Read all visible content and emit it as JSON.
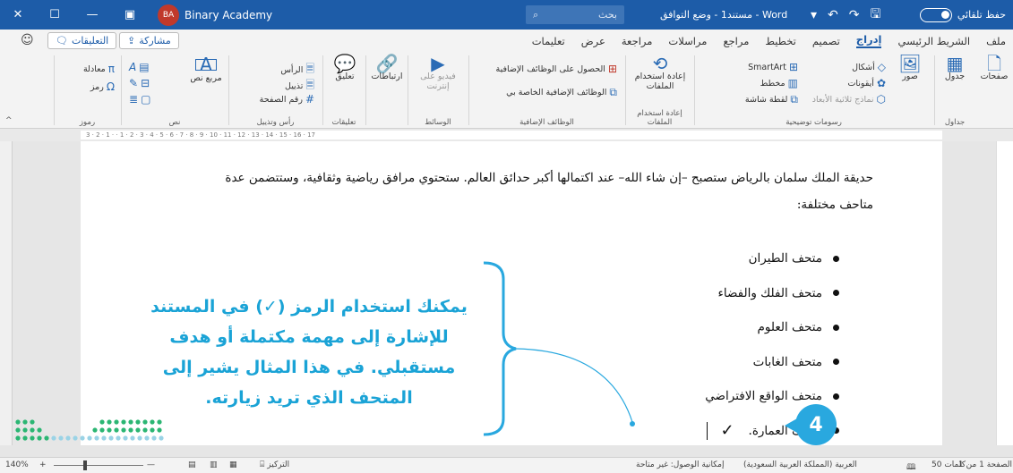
{
  "titlebar": {
    "account_initials": "BA",
    "account_name": "Binary Academy",
    "search_placeholder": "بحث",
    "doc_title": "مستند1 - وضع التوافق - Word",
    "autosave_label": "حفظ تلقائي"
  },
  "tabs": [
    "ملف",
    "الشريط الرئيسي",
    "إدراج",
    "تصميم",
    "تخطيط",
    "مراجع",
    "مراسلات",
    "مراجعة",
    "عرض",
    "تعليمات"
  ],
  "active_tab": "إدراج",
  "share_label": "مشاركة",
  "comments_label": "التعليقات",
  "ribbon": {
    "pages": "صفحات",
    "table": "جدول",
    "tables_group": "جداول",
    "pictures": "صور",
    "shapes": "أشكال",
    "icons": "أيقونات",
    "models_3d": "نماذج ثلاثية الأبعاد",
    "smartart": "SmartArt",
    "chart": "مخطط",
    "screenshot": "لقطة شاشة",
    "illustrations_group": "رسومات توضيحية",
    "reuse_files": "إعادة استخدام الملفات",
    "reuse_group": "إعادة استخدام الملفات",
    "get_addins": "الحصول على الوظائف الإضافية",
    "my_addins": "الوظائف الإضافية الخاصة بي",
    "addins_group": "الوظائف الإضافية",
    "online_video": "فيديو على إنترنت",
    "media_group": "الوسائط",
    "links": "ارتباطات",
    "comment": "تعليق",
    "comments_group": "تعليقات",
    "header": "الرأس",
    "footer": "تذييل",
    "page_number": "رقم الصفحة",
    "header_footer_group": "رأس وتذييل",
    "text_box": "مربع نص",
    "text_group": "نص",
    "equation": "معادلة",
    "symbol": "رمز",
    "symbols_group": "رموز"
  },
  "ruler_ticks": "3 · 2 · 1 · · 1 · 2 · 3 · 4 · 5 · 6 · 7 · 8 · 9 · 10 · 11 · 12 · 13 · 14 · 15 · 16 · 17",
  "document": {
    "paragraph": "حديقة الملك سلمان بالرياض ستصبح –إن شاء الله– عند اكتمالها أكبر حدائق العالم. ستحتوي مرافق رياضية وثقافية، وستتضمن عدة متاحف مختلفة:",
    "bullets": [
      "متحف الطيران",
      "متحف الفلك والفضاء",
      "متحف العلوم",
      "متحف الغابات",
      "متحف الواقع الافتراضي",
      "متحف العمارة."
    ],
    "checkmark": "✓"
  },
  "callout": {
    "text": "يمكنك استخدام الرمز (✓) في المستند للإشارة إلى مهمة مكتملة أو هدف مستقبلي. في هذا المثال يشير إلى المتحف الذي تريد زيارته.",
    "badge": "4",
    "color": "#1aa3d6"
  },
  "statusbar": {
    "page": "الصفحة 1 من 1",
    "words": "50 كلمات",
    "language": "العربية (المملكة العربية السعودية)",
    "accessibility": "إمكانية الوصول: غير متاحة",
    "focus": "التركيز",
    "zoom": "140%"
  },
  "colors": {
    "title_bar": "#1d5ca8",
    "accent": "#29a8df"
  }
}
